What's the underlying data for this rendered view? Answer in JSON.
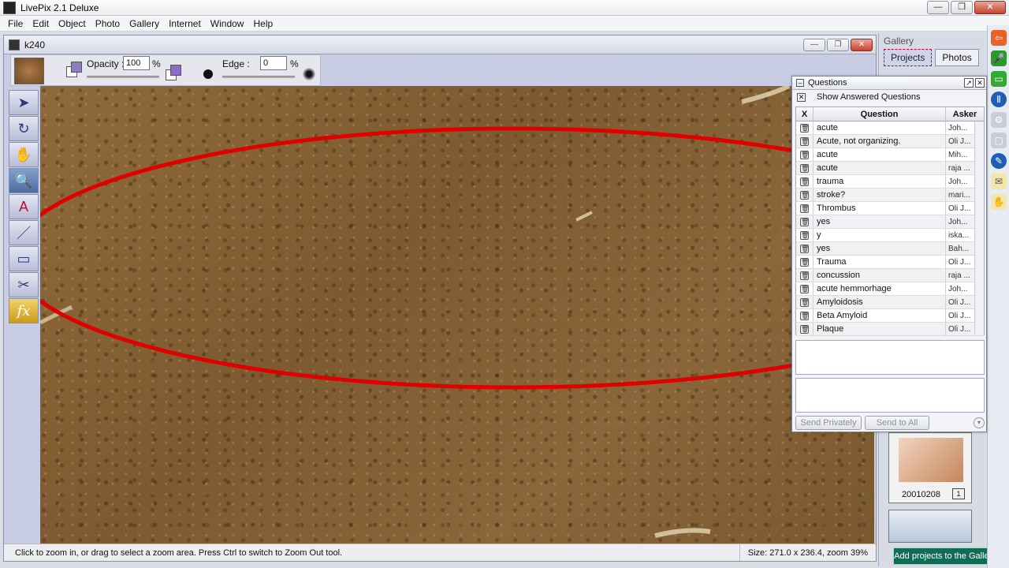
{
  "app": {
    "title": "LivePix 2.1 Deluxe",
    "minimize": "—",
    "restore": "❐",
    "close": "✕"
  },
  "menu": [
    "File",
    "Edit",
    "Object",
    "Photo",
    "Gallery",
    "Internet",
    "Window",
    "Help"
  ],
  "document": {
    "title": "k240"
  },
  "options": {
    "opacity_label": "Opacity :",
    "opacity_value": "100",
    "opacity_unit": "%",
    "edge_label": "Edge :",
    "edge_value": "0",
    "edge_unit": "%"
  },
  "status": {
    "hint": "Click to zoom in, or drag to select a zoom area. Press Ctrl to switch to Zoom Out tool.",
    "size": "Size: 271.0 x 236.4, zoom 39%"
  },
  "gallery": {
    "title": "Gallery",
    "tabs": [
      "Projects",
      "Photos"
    ],
    "item_label": "20010208",
    "item_badge": "1",
    "add_button": "Add projects to the Gallery"
  },
  "questions": {
    "title": "Questions",
    "show_answered": "Show Answered Questions",
    "columns": {
      "x": "X",
      "question": "Question",
      "asker": "Asker"
    },
    "rows": [
      {
        "q": "acute",
        "a": "Joh..."
      },
      {
        "q": "Acute, not organizing.",
        "a": "Oli J..."
      },
      {
        "q": "acute",
        "a": "Mih..."
      },
      {
        "q": "acute",
        "a": "raja ..."
      },
      {
        "q": "trauma",
        "a": "Joh..."
      },
      {
        "q": "stroke?",
        "a": "mari..."
      },
      {
        "q": "Thrombus",
        "a": "Oli J..."
      },
      {
        "q": "yes",
        "a": "Joh..."
      },
      {
        "q": "y",
        "a": "iska..."
      },
      {
        "q": "yes",
        "a": "Bah..."
      },
      {
        "q": " Trauma",
        "a": "Oli J..."
      },
      {
        "q": "concussion",
        "a": "raja ..."
      },
      {
        "q": "acute hemmorhage",
        "a": "Joh..."
      },
      {
        "q": "Amyloidosis",
        "a": "Oli J..."
      },
      {
        "q": "Beta Amyloid",
        "a": "Oli J..."
      },
      {
        "q": "Plaque",
        "a": "Oli J..."
      }
    ],
    "send_private": "Send Privately",
    "send_all": "Send to All"
  },
  "annotation_color": "#e00000"
}
